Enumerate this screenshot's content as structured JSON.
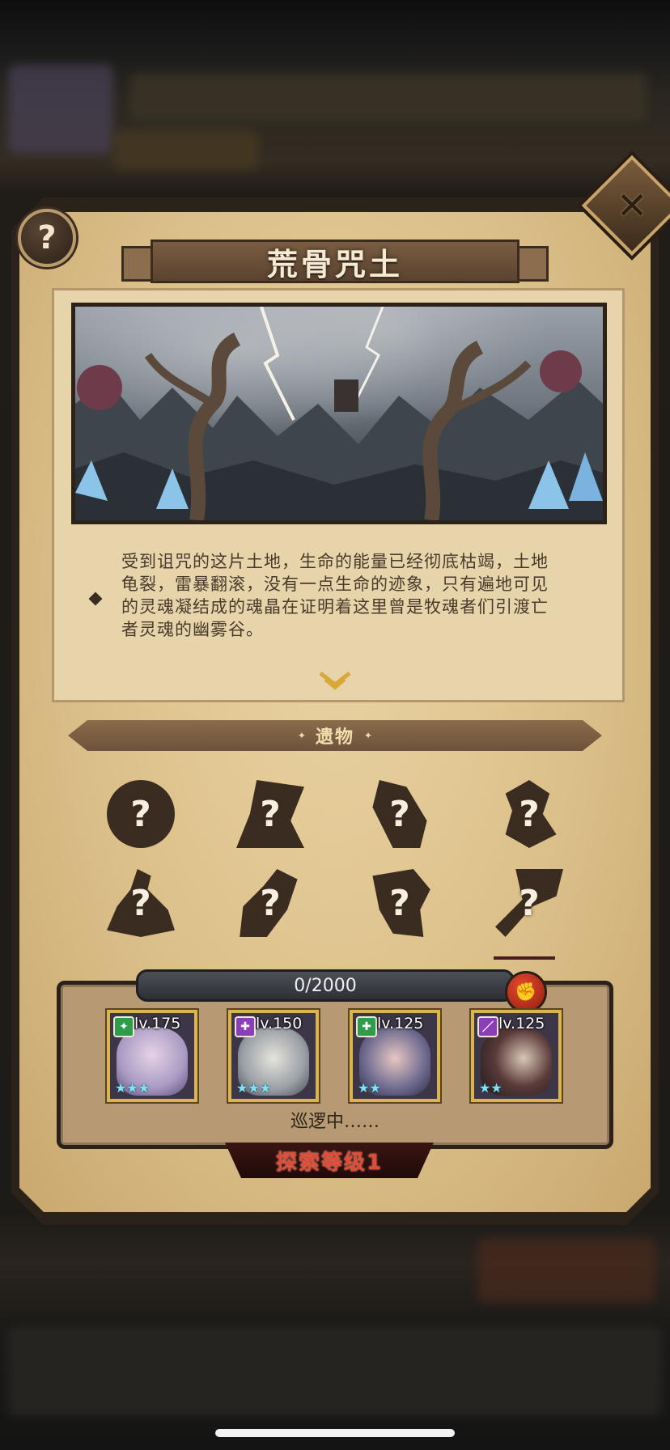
{
  "zone": {
    "title": "荒骨咒土",
    "description": "受到诅咒的这片土地，生命的能量已经彻底枯竭，土地龟裂，雷暴翻滚，没有一点生命的迹象，只有遍地可见的灵魂凝结成的魂晶在证明着这里曾是牧魂者们引渡亡者灵魂的幽雾谷。",
    "help_icon": "question-icon",
    "help_label": "?",
    "close_icon": "close-x-icon",
    "close_label": "✕",
    "expand_icon": "chevron-down-icon"
  },
  "relics": {
    "section_title": "遗物",
    "unknown_label": "?",
    "items": [
      {
        "name": "relic-1",
        "state": "locked"
      },
      {
        "name": "relic-2",
        "state": "locked"
      },
      {
        "name": "relic-3",
        "state": "locked"
      },
      {
        "name": "relic-4",
        "state": "locked"
      },
      {
        "name": "relic-5",
        "state": "locked"
      },
      {
        "name": "relic-6",
        "state": "locked"
      },
      {
        "name": "relic-7",
        "state": "locked"
      },
      {
        "name": "relic-8",
        "state": "locked"
      }
    ]
  },
  "team": {
    "progress_text": "0/2000",
    "progress_value": 0,
    "progress_max": 2000,
    "fist_icon": "fist-icon",
    "status_text": "巡逻中……",
    "heroes": [
      {
        "level": "lv.175",
        "class": "green",
        "class_color": "#2e9c4a",
        "class_glyph": "✦",
        "stars": "★★★",
        "face_color": "#a99bc4"
      },
      {
        "level": "lv.150",
        "class": "purple",
        "class_color": "#8a3fb8",
        "class_glyph": "✚",
        "stars": "★★★",
        "face_color": "#9aa0a6"
      },
      {
        "level": "lv.125",
        "class": "green",
        "class_color": "#2e9c4a",
        "class_glyph": "✚",
        "stars": "★★",
        "face_color": "#6d6a8f"
      },
      {
        "level": "lv.125",
        "class": "purple",
        "class_color": "#8a3fb8",
        "class_glyph": "／",
        "stars": "★★",
        "face_color": "#3b3030"
      }
    ]
  },
  "exploration": {
    "level_label": "探索等级1"
  },
  "colors": {
    "parchment": "#dcc08a",
    "frame_dark": "#2b221a",
    "accent_gold": "#d9b451",
    "level_red": "#e24a36",
    "star_cyan": "#7fe3f5"
  }
}
